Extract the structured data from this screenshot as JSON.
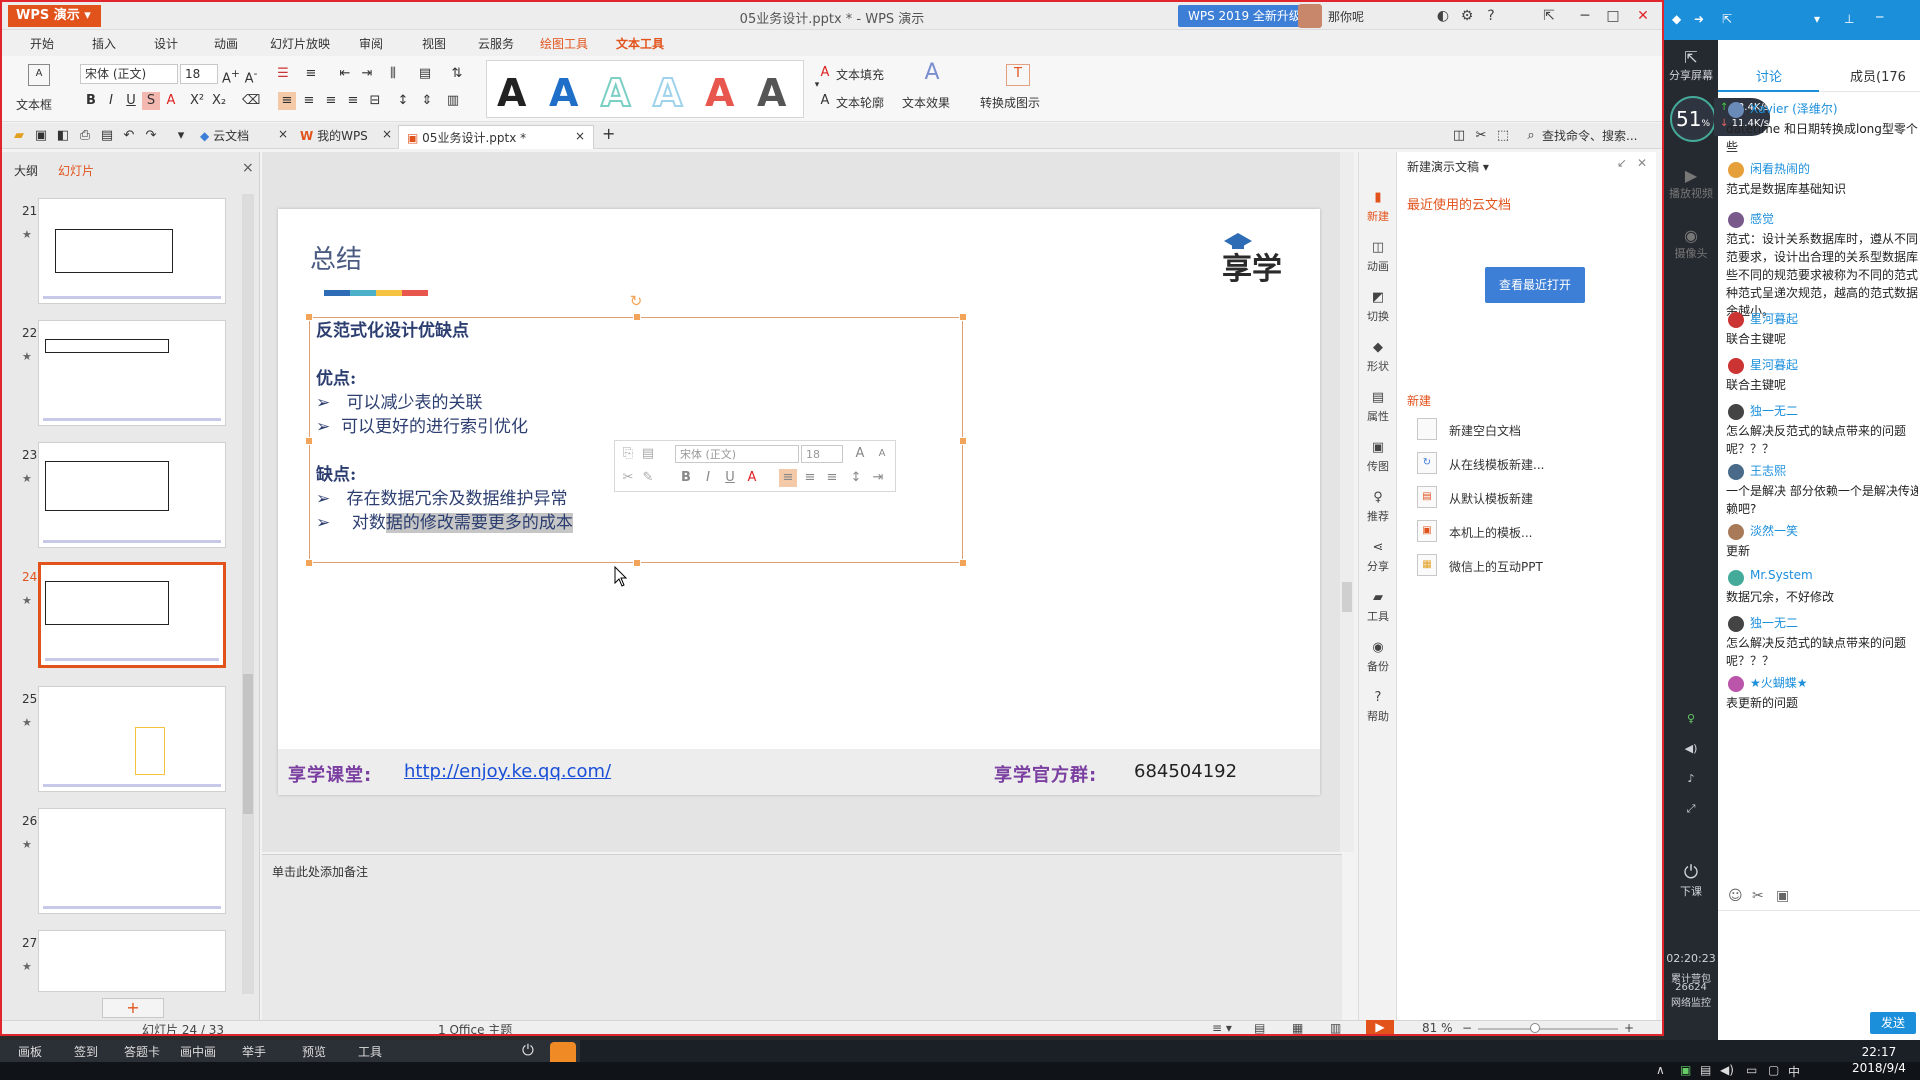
{
  "app": {
    "logo_label": "WPS 演示",
    "doc_title": "05业务设计.pptx * - WPS 演示",
    "upgrade_label": "WPS 2019 全新升级",
    "user_name": "那你呢"
  },
  "ribbon_tabs": [
    "开始",
    "插入",
    "设计",
    "动画",
    "幻灯片放映",
    "审阅",
    "视图",
    "云服务",
    "绘图工具",
    "文本工具"
  ],
  "ribbon": {
    "textbox_label": "文本框",
    "font_name": "宋体 (正文)",
    "font_size": "18",
    "text_fill": "文本填充",
    "text_outline": "文本轮廓",
    "text_effect": "文本效果",
    "convert_label": "转换成图示",
    "style_colors": [
      "#222222",
      "#1f6fc9",
      "#7ccfc4",
      "#9fd3ec",
      "#e8574d",
      "#555555"
    ]
  },
  "doc_tabs": {
    "cloud": "云文档",
    "mywps": "我的WPS",
    "current": "05业务设计.pptx *",
    "search_hint": "查找命令、搜索..."
  },
  "left_panel": {
    "tab_outline": "大纲",
    "tab_slides": "幻灯片",
    "slides": [
      {
        "num": "21"
      },
      {
        "num": "22"
      },
      {
        "num": "23"
      },
      {
        "num": "24"
      },
      {
        "num": "25"
      },
      {
        "num": "26"
      },
      {
        "num": "27"
      }
    ]
  },
  "slide": {
    "title": "总结",
    "heading": "反范式化设计优缺点",
    "pros_label": "优点:",
    "pros": [
      "可以减少表的关联",
      "可以更好的进行索引优化"
    ],
    "cons_label": "缺点:",
    "cons": [
      "存在数据冗余及数据维护异常"
    ],
    "cons_last_plain": "对数",
    "cons_last_highlight": "据的修改需要更多的成本",
    "footer_label1": "享学课堂:",
    "footer_link": "http://enjoy.ke.qq.com/",
    "footer_label2": "享学官方群:",
    "footer_group": "684504192",
    "logo_text": "享学",
    "title_bar_colors": [
      "#2e6db5",
      "#4bb0c8",
      "#f5c242",
      "#e8574d"
    ]
  },
  "mini_toolbar": {
    "font_name": "宋体 (正文)",
    "font_size": "18"
  },
  "notes_placeholder": "单击此处添加备注",
  "toolstrip": [
    "新建",
    "动画",
    "切换",
    "形状",
    "属性",
    "传图",
    "推荐",
    "分享",
    "工具",
    "备份",
    "帮助"
  ],
  "taskpane": {
    "header": "新建演示文稿",
    "recent_label": "最近使用的云文档",
    "recent_button": "查看最近打开",
    "new_label": "新建",
    "items": [
      "新建空白文档",
      "从在线模板新建...",
      "从默认模板新建",
      "本机上的模板...",
      "微信上的互动PPT"
    ]
  },
  "statusbar": {
    "slide_counter": "幻灯片 24 / 33",
    "theme": "1 Office 主题",
    "zoom": "81 %"
  },
  "live": {
    "share_screen": "分享屏幕",
    "percent": "51",
    "up_speed": "12.4K/s",
    "down_speed": "11.4K/s",
    "tab_discuss": "讨论",
    "tab_members": "成员(176",
    "side_items": [
      "播放视频",
      "摄像头",
      "下课"
    ],
    "time": "02:20:23",
    "stats1": "累计营包",
    "stats2": "26624",
    "stats3": "网络监控",
    "messages": [
      {
        "user": "Xavier (泽维尔)",
        "text": [
          "datetime 和日期转换成long型零个位",
          "些"
        ]
      },
      {
        "user": "闲看热闹的",
        "text": [
          "范式是数据库基础知识"
        ]
      },
      {
        "user": "感觉",
        "text": [
          "范式：设计关系数据库时，遵从不同",
          "范要求，设计出合理的关系型数据库",
          "些不同的规范要求被称为不同的范式",
          "种范式呈递次规范，越高的范式数据",
          "余越小。"
        ]
      },
      {
        "user": "星河暮起",
        "text": [
          "联合主键呢"
        ]
      },
      {
        "user": "星河暮起",
        "text": [
          "联合主键呢"
        ]
      },
      {
        "user": "独一无二",
        "text": [
          "怎么解决反范式的缺点带来的问题",
          "呢？？？"
        ]
      },
      {
        "user": "王志熙",
        "text": [
          "一个是解决 部分依赖一个是解决传递",
          "赖吧?"
        ]
      },
      {
        "user": "淡然一笑",
        "text": [
          "更新"
        ]
      },
      {
        "user": "Mr.System",
        "text": [
          "数据冗余，不好修改"
        ]
      },
      {
        "user": "独一无二",
        "text": [
          "怎么解决反范式的缺点带来的问题",
          "呢？？？"
        ]
      },
      {
        "user": "★火蝴蝶★",
        "text": [
          "表更新的问题"
        ]
      }
    ],
    "send_label": "发送"
  },
  "taskbar": {
    "items": [
      "画板",
      "签到",
      "答题卡",
      "画中画",
      "举手",
      "预览",
      "工具"
    ],
    "clock_time": "22:17",
    "clock_date": "2018/9/4",
    "ime": "中"
  }
}
